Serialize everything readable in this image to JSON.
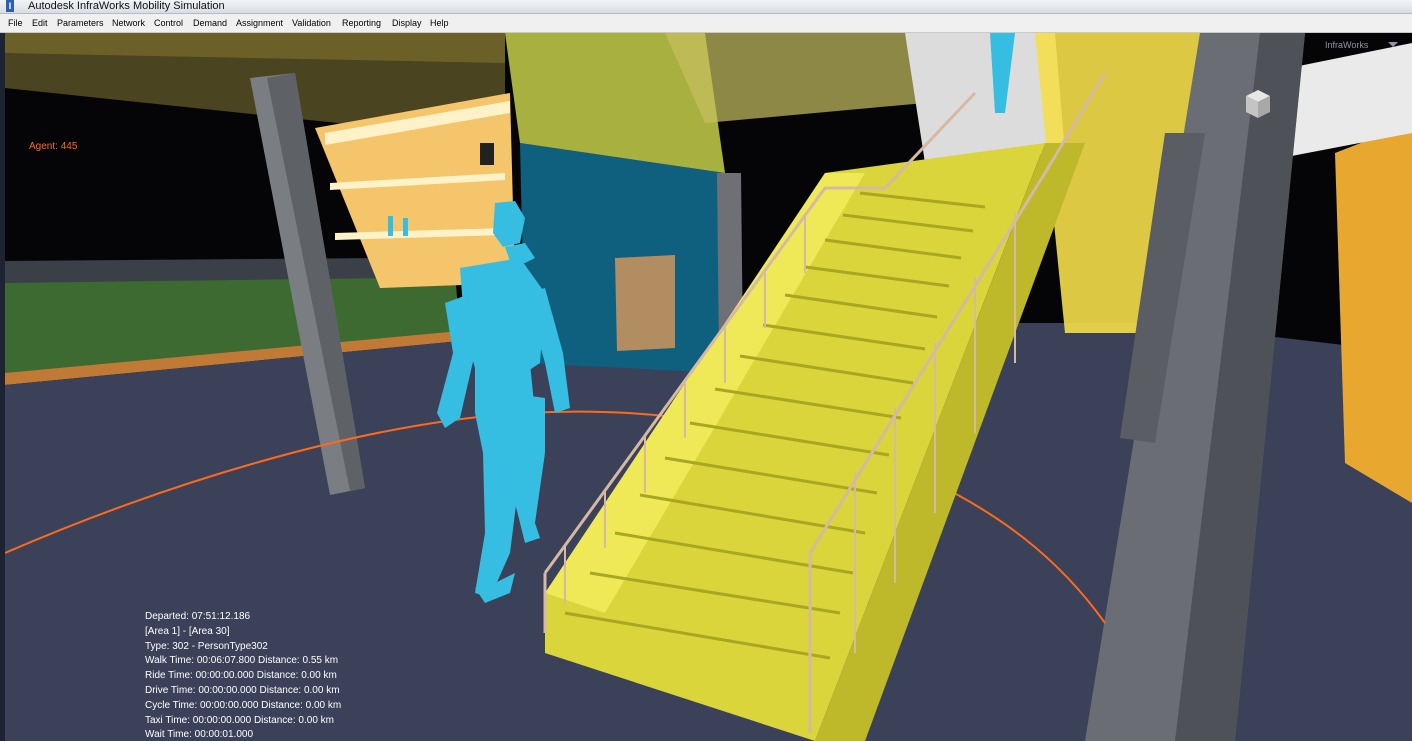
{
  "window": {
    "title": "Autodesk InfraWorks Mobility Simulation",
    "icon": "app-icon"
  },
  "menu": [
    "File",
    "Edit",
    "Parameters",
    "Network",
    "Control",
    "Demand",
    "Assignment",
    "Validation",
    "Reporting",
    "Display",
    "Help"
  ],
  "viewport": {
    "agent_label": "Agent: 445",
    "brand_label": "InfraWorks",
    "viewcube_icon": "viewcube-icon"
  },
  "agent_info": [
    "Departed: 07:51:12.186",
    "[Area 1] - [Area 30]",
    "Type: 302 - PersonType302",
    "Walk Time: 00:06:07.800 Distance: 0.55 km",
    "Ride Time: 00:00:00.000 Distance: 0.00 km",
    "Drive Time: 00:00:00.000 Distance: 0.00 km",
    "Cycle Time: 00:00:00.000 Distance: 0.00 km",
    "Taxi Time: 00:00:00.000 Distance: 0.00 km",
    "Wait Time: 00:00:01.000"
  ],
  "colors": {
    "agent": "#35bde2",
    "stair": "#e6e23c",
    "railing": "#d6b9a2",
    "path": "#ff6a1a",
    "floor": "#3b4158"
  }
}
